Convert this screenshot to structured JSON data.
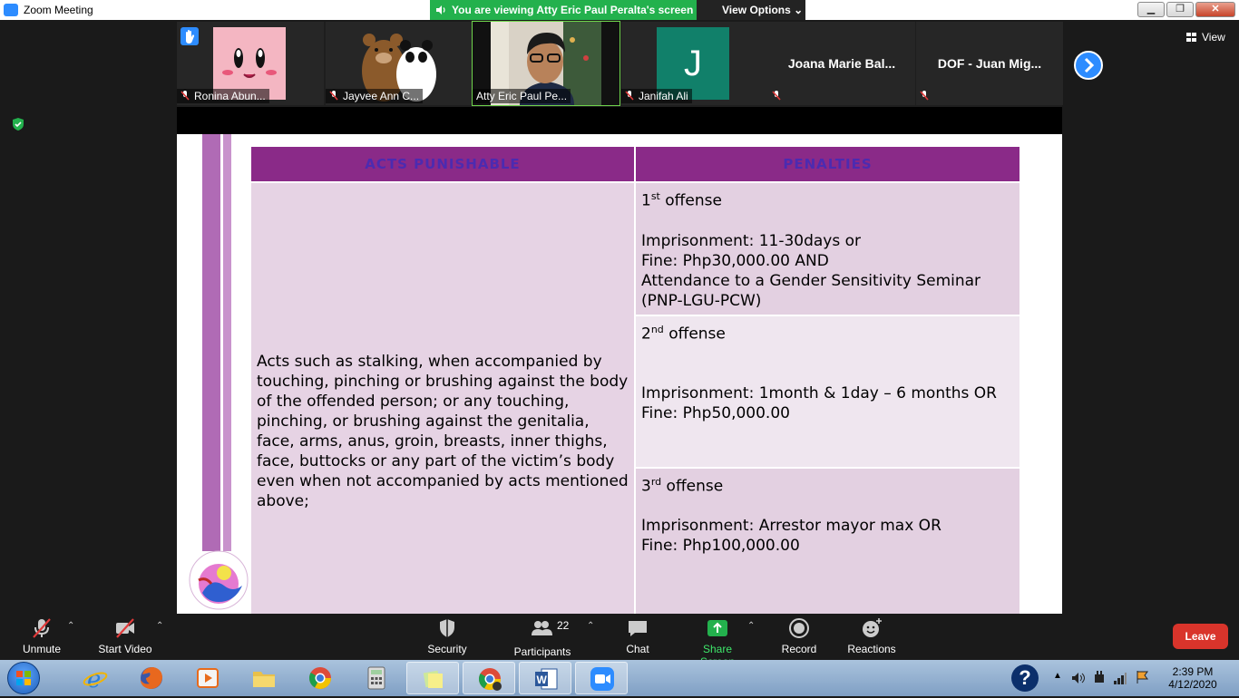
{
  "window": {
    "title": "Zoom Meeting"
  },
  "banner": {
    "viewing_text": "You are viewing Atty Eric Paul Peralta's screen",
    "view_options_label": "View Options"
  },
  "view": {
    "label": "View"
  },
  "participants_strip": [
    {
      "name": "Ronina Abun...",
      "muted": true,
      "hand_raised": true
    },
    {
      "name": "Jayvee Ann C...",
      "muted": true
    },
    {
      "name": "Atty Eric Paul Pe...",
      "muted": false,
      "active_speaker": true
    },
    {
      "name": "Janifah Ali",
      "muted": true,
      "avatar_letter": "J",
      "avatar_color": "#11806a"
    },
    {
      "name": "Joana Marie Bal...",
      "muted": true
    },
    {
      "name": "DOF - Juan Mig...",
      "muted": true
    }
  ],
  "slide": {
    "headers": [
      "ACTS PUNISHABLE",
      "PENALTIES"
    ],
    "acts_text": "Acts such as stalking, when accompanied by touching, pinching or brushing against the body of the offended person; or any touching, pinching, or brushing against the genitalia, face, arms, anus, groin, breasts, inner thighs, face, buttocks or any part of the victim’s body even when not accompanied by acts mentioned above;",
    "offenses": [
      {
        "num": "1",
        "sup": "st",
        "label": "offense",
        "lines": [
          "Imprisonment: 11-30days or",
          "Fine: Php30,000.00 AND",
          "Attendance to a Gender Sensitivity Seminar (PNP-LGU-PCW)"
        ]
      },
      {
        "num": "2",
        "sup": "nd",
        "label": "offense",
        "lines": [
          "Imprisonment: 1month & 1day – 6 months OR",
          "Fine: Php50,000.00"
        ]
      },
      {
        "num": "3",
        "sup": "rd",
        "label": "offense",
        "lines": [
          "Imprisonment: Arrestor mayor max OR",
          "Fine: Php100,000.00"
        ]
      }
    ]
  },
  "controls": {
    "unmute": "Unmute",
    "start_video": "Start Video",
    "security": "Security",
    "participants": "Participants",
    "participants_count": "22",
    "chat": "Chat",
    "share_screen": "Share Screen",
    "record": "Record",
    "reactions": "Reactions",
    "leave": "Leave"
  },
  "taskbar": {
    "time": "2:39 PM",
    "date": "4/12/2020",
    "help_icon": "?"
  },
  "colors": {
    "zoom_blue": "#2d8cff",
    "banner_green": "#23b14d",
    "header_purple": "#8a2a88",
    "leave_red": "#d9342b"
  }
}
